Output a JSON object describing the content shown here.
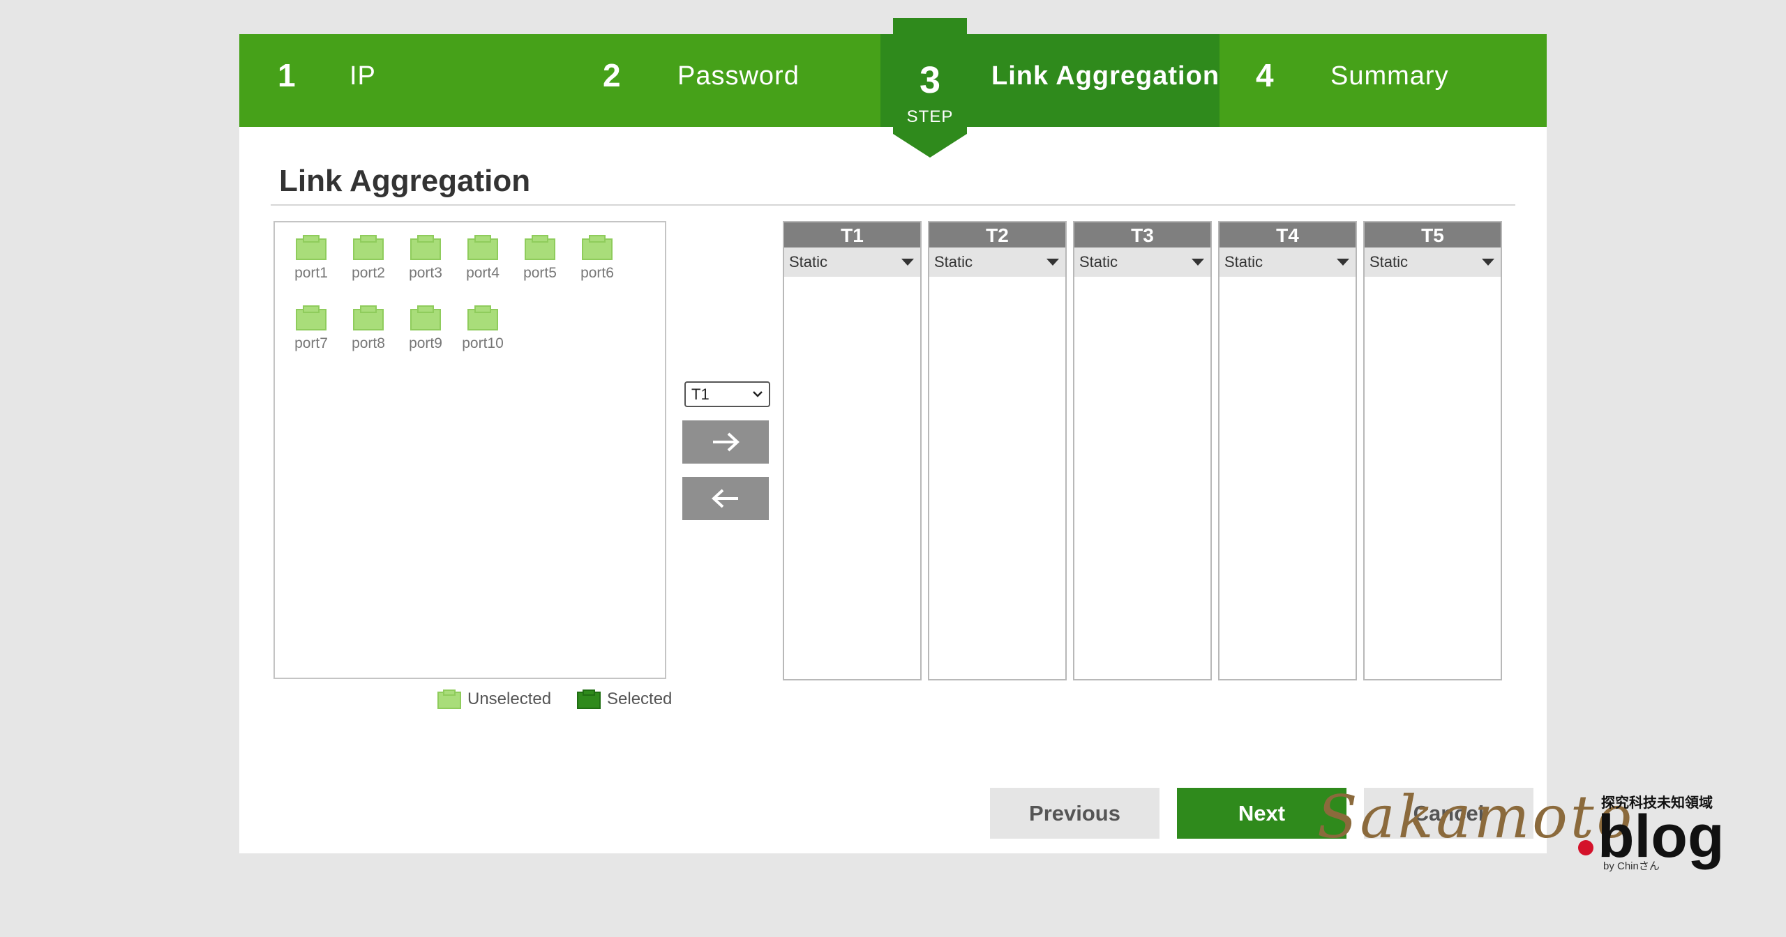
{
  "colors": {
    "brand_green": "#46a119",
    "active_step_green": "#2f8a1c",
    "port_unselected": "#a9dd7a",
    "port_selected": "#2f8a1c",
    "trunk_header_gray": "#7f7f7f",
    "arrow_button_gray": "#8f8f8f"
  },
  "steps": [
    {
      "number": "1",
      "label": "IP"
    },
    {
      "number": "2",
      "label": "Password"
    },
    {
      "number": "3",
      "label": "Link Aggregation",
      "badge": "STEP",
      "active": true
    },
    {
      "number": "4",
      "label": "Summary"
    }
  ],
  "page": {
    "title": "Link Aggregation"
  },
  "ports": [
    "port1",
    "port2",
    "port3",
    "port4",
    "port5",
    "port6",
    "port7",
    "port8",
    "port9",
    "port10"
  ],
  "legend": {
    "unselected": "Unselected",
    "selected": "Selected"
  },
  "trunk_selector": {
    "value": "T1",
    "options_visible": [
      "T1"
    ]
  },
  "move_buttons": {
    "right_icon": "arrow-right-icon",
    "left_icon": "arrow-left-icon"
  },
  "trunks": [
    {
      "name": "T1",
      "mode": "Static"
    },
    {
      "name": "T2",
      "mode": "Static"
    },
    {
      "name": "T3",
      "mode": "Static"
    },
    {
      "name": "T4",
      "mode": "Static"
    },
    {
      "name": "T5",
      "mode": "Static"
    }
  ],
  "buttons": {
    "previous": "Previous",
    "next": "Next",
    "cancel": "Cancel"
  },
  "watermark": {
    "main": "Sakamoto",
    "blog": "blog",
    "tagline": "探究科技未知領域",
    "by": "by Chinさん"
  }
}
